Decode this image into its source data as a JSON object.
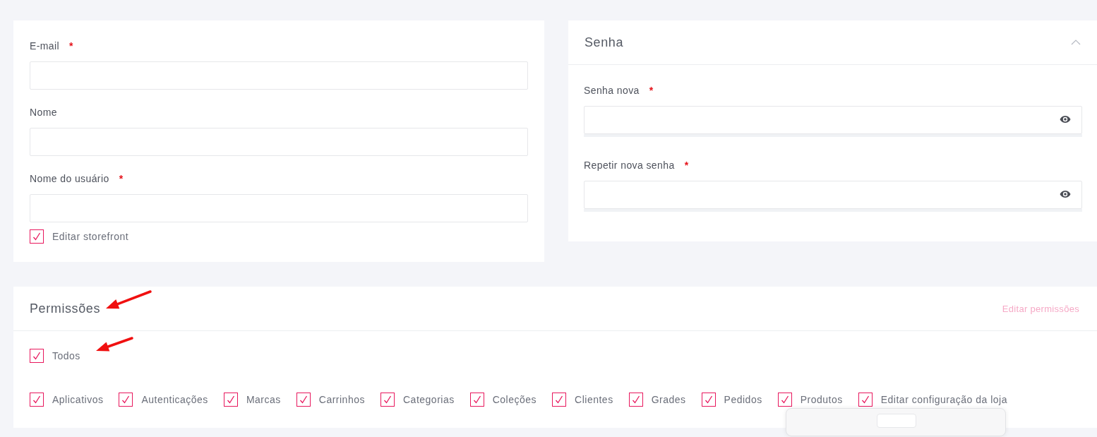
{
  "account": {
    "fields": [
      {
        "label": "E-mail",
        "marker": "*"
      },
      {
        "label": "Nome"
      },
      {
        "label": "Nome do usuário",
        "marker": "*"
      }
    ],
    "storefront": {
      "label": "Editar storefront",
      "checked": true
    }
  },
  "password": {
    "title": "Senha",
    "expanded": true,
    "fields": [
      {
        "label": "Senha nova",
        "marker": "*"
      },
      {
        "label": "Repetir nova senha",
        "marker": "*"
      }
    ]
  },
  "permissions": {
    "title": "Permissões",
    "edit_link": "Editar permissões",
    "all": {
      "label": "Todos",
      "checked": true
    },
    "items": [
      {
        "label": "Aplicativos",
        "checked": true
      },
      {
        "label": "Autenticações",
        "checked": true
      },
      {
        "label": "Marcas",
        "checked": true
      },
      {
        "label": "Carrinhos",
        "checked": true
      },
      {
        "label": "Categorias",
        "checked": true
      },
      {
        "label": "Coleções",
        "checked": true
      },
      {
        "label": "Clientes",
        "checked": true
      },
      {
        "label": "Grades",
        "checked": true
      },
      {
        "label": "Pedidos",
        "checked": true
      },
      {
        "label": "Produtos",
        "checked": true
      },
      {
        "label": "Editar configuração da loja",
        "checked": true
      }
    ]
  }
}
